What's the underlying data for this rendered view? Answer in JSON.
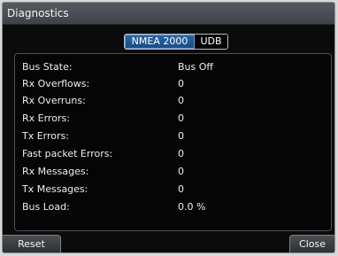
{
  "window": {
    "title": "Diagnostics"
  },
  "tabs": [
    {
      "label": "NMEA 2000",
      "selected": true
    },
    {
      "label": "UDB",
      "selected": false
    }
  ],
  "diagnostics": [
    {
      "label": "Bus State:",
      "value": "Bus Off"
    },
    {
      "label": "Rx Overflows:",
      "value": "0"
    },
    {
      "label": "Rx Overruns:",
      "value": "0"
    },
    {
      "label": "Rx Errors:",
      "value": "0"
    },
    {
      "label": "Tx Errors:",
      "value": "0"
    },
    {
      "label": "Fast packet Errors:",
      "value": "0"
    },
    {
      "label": "Rx Messages:",
      "value": "0"
    },
    {
      "label": "Tx Messages:",
      "value": "0"
    },
    {
      "label": "Bus Load:",
      "value": "0.0 %"
    }
  ],
  "buttons": {
    "reset": "Reset",
    "close": "Close"
  },
  "colors": {
    "background": "#0b0b0b",
    "title_bar": "#4b4f55",
    "selected_tab": "#1f5a98",
    "text": "#eeeeee"
  }
}
